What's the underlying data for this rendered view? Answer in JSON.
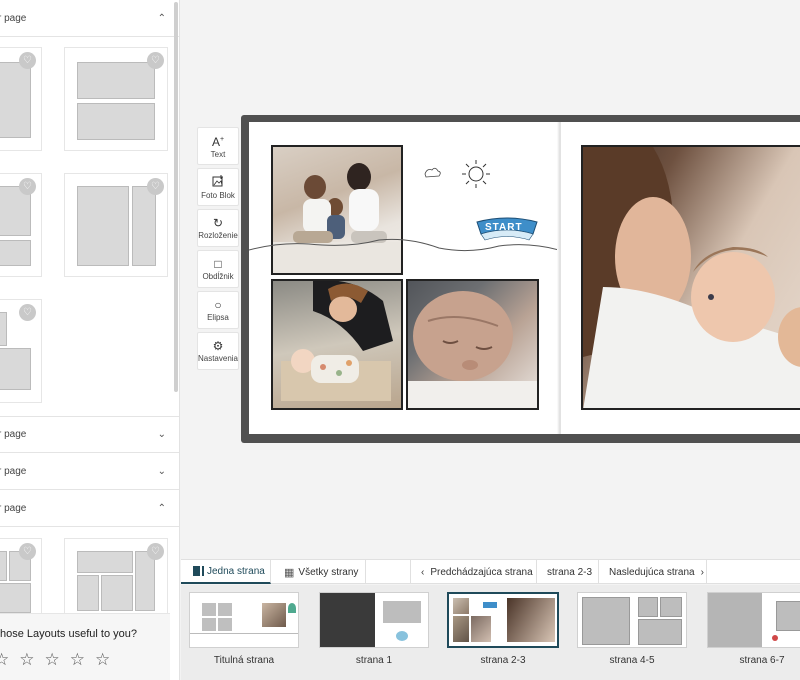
{
  "left_panel": {
    "sections": [
      {
        "title": "r page",
        "expanded": true
      },
      {
        "title": "r page",
        "expanded": false
      },
      {
        "title": "r page",
        "expanded": false
      },
      {
        "title": "r page",
        "expanded": true
      }
    ],
    "survey": {
      "question": "hose Layouts useful to you?",
      "stars": [
        "☆",
        "☆",
        "☆",
        "☆",
        "☆"
      ]
    }
  },
  "toolbar": {
    "text_label": "Text",
    "photo_block_label": "Foto Blok",
    "layout_label": "Rozloženie",
    "rectangle_label": "Obdĺžnik",
    "ellipse_label": "Elipsa",
    "settings_label": "Nastavenia"
  },
  "canvas": {
    "sticker_text": "START"
  },
  "navbar": {
    "single_page": "Jedna strana",
    "all_pages": "Všetky strany",
    "previous_page": "Predchádzajúca strana",
    "current_page": "strana 2-3",
    "next_page": "Nasledujúca strana"
  },
  "thumbnails": [
    {
      "label": "Titulná strana",
      "selected": false
    },
    {
      "label": "strana 1",
      "selected": false
    },
    {
      "label": "strana 2-3",
      "selected": true
    },
    {
      "label": "strana 4-5",
      "selected": false
    },
    {
      "label": "strana 6-7",
      "selected": false
    }
  ],
  "colors": {
    "accent": "#1f4a5a",
    "book_frame": "#505050",
    "placeholder": "#d9d9d9"
  }
}
